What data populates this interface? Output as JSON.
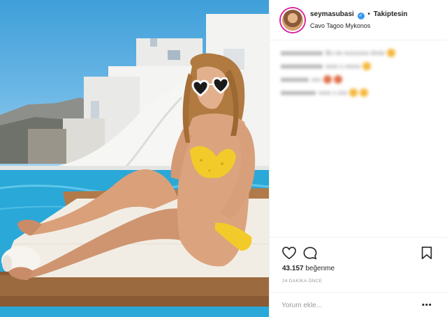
{
  "post": {
    "username": "seymasubasi",
    "verified": true,
    "separator": "•",
    "follow_status": "Takiptesin",
    "location": "Cavo Tagoo Mykonos",
    "likes_count": "43.157",
    "likes_label": "beğenme",
    "time_ago": "24 DAKİKA ÖNCE",
    "comment_placeholder": "Yorum ekle...",
    "more_label": "•••"
  },
  "comments": [
    {
      "user": "xxxxxxxxxxxx",
      "text": "Bu ne xxxxxxxx ömür"
    },
    {
      "user": "xxxxxxxxxxxx",
      "text": "xxxx x xxxxx"
    },
    {
      "user": "xxxxxxxx",
      "text": "xxx"
    },
    {
      "user": "xxxxxxxxxx",
      "text": "xxxx x xxx"
    }
  ],
  "icons": {
    "like": "heart-icon",
    "comment": "comment-icon",
    "save": "bookmark-icon",
    "verified": "verified-badge-icon",
    "more": "more-options-icon"
  },
  "colors": {
    "verified": "#3897f0",
    "text": "#262626",
    "muted": "#999999",
    "pool": "#2aa8d8",
    "bikini": "#f2cb2a"
  }
}
